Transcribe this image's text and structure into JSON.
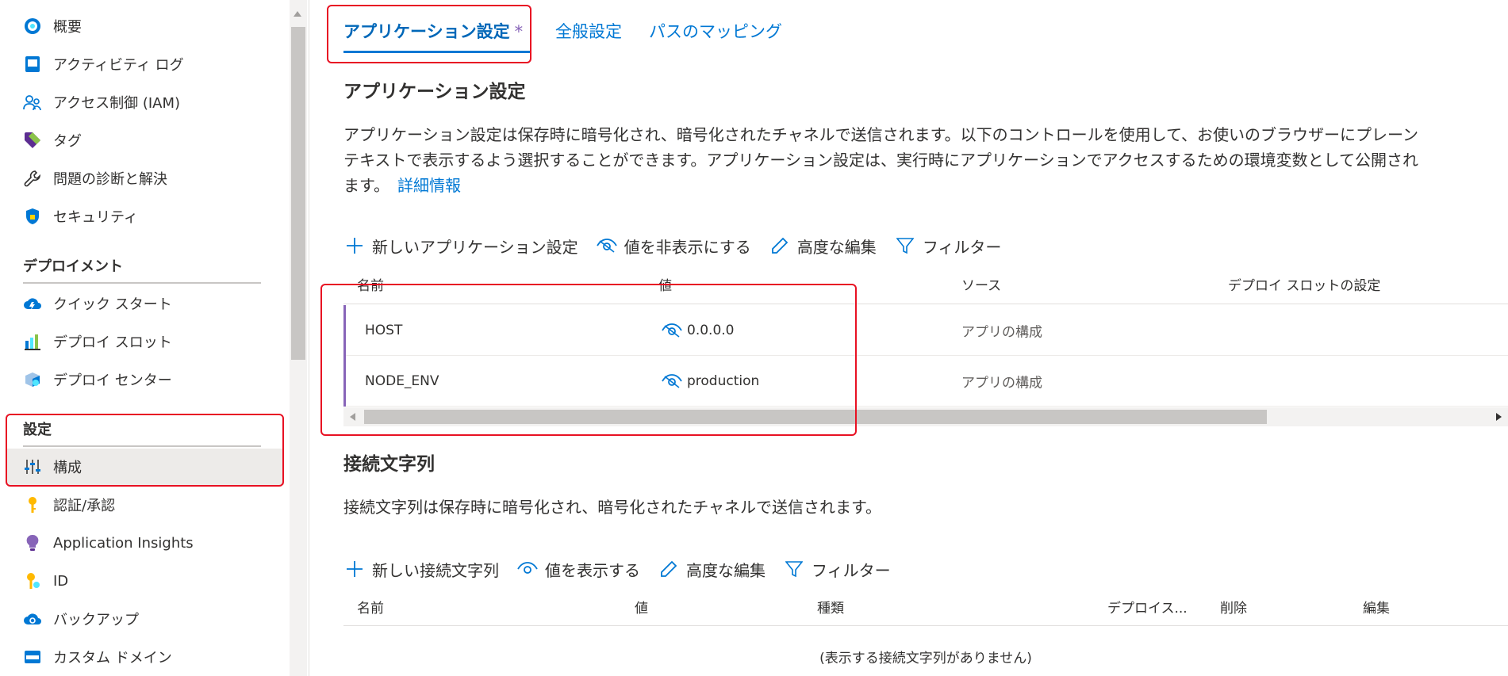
{
  "sidebar": {
    "items_top": [
      {
        "label": "概要",
        "icon": "overview-icon"
      },
      {
        "label": "アクティビティ ログ",
        "icon": "activity-log-icon"
      },
      {
        "label": "アクセス制御 (IAM)",
        "icon": "access-control-icon"
      },
      {
        "label": "タグ",
        "icon": "tag-icon"
      },
      {
        "label": "問題の診断と解決",
        "icon": "wrench-icon"
      },
      {
        "label": "セキュリティ",
        "icon": "shield-icon"
      }
    ],
    "deployment_header": "デプロイメント",
    "deployment_items": [
      {
        "label": "クイック スタート",
        "icon": "cloud-icon"
      },
      {
        "label": "デプロイ スロット",
        "icon": "slots-icon"
      },
      {
        "label": "デプロイ センター",
        "icon": "deploy-center-icon"
      }
    ],
    "settings_header": "設定",
    "settings_items": [
      {
        "label": "構成",
        "icon": "sliders-icon",
        "selected": true
      },
      {
        "label": "認証/承認",
        "icon": "key-icon"
      },
      {
        "label": "Application Insights",
        "icon": "lightbulb-icon"
      },
      {
        "label": "ID",
        "icon": "identity-key-icon"
      },
      {
        "label": "バックアップ",
        "icon": "backup-icon"
      },
      {
        "label": "カスタム ドメイン",
        "icon": "domain-icon"
      }
    ]
  },
  "tabs": [
    {
      "label": "アプリケーション設定",
      "active": true,
      "modified_marker": "*"
    },
    {
      "label": "全般設定",
      "active": false
    },
    {
      "label": "パスのマッピング",
      "active": false
    }
  ],
  "app_settings": {
    "heading": "アプリケーション設定",
    "description_line1": "アプリケーション設定は保存時に暗号化され、暗号化されたチャネルで送信されます。以下のコントロールを使用して、お使いのブラウザーにプレーン",
    "description_line2": "テキストで表示するよう選択することができます。アプリケーション設定は、実行時にアプリケーションでアクセスするための環境変数として公開され",
    "description_line3": "ます。",
    "learn_more": "詳細情報",
    "toolbar": {
      "new": "新しいアプリケーション設定",
      "toggle_values": "値を非表示にする",
      "advanced_edit": "高度な編集",
      "filter": "フィルター"
    },
    "columns": {
      "name": "名前",
      "value": "値",
      "source": "ソース",
      "slot": "デプロイ スロットの設定"
    },
    "rows": [
      {
        "name": "HOST",
        "value": "0.0.0.0",
        "source": "アプリの構成"
      },
      {
        "name": "NODE_ENV",
        "value": "production",
        "source": "アプリの構成"
      }
    ]
  },
  "connection_strings": {
    "heading": "接続文字列",
    "description": "接続文字列は保存時に暗号化され、暗号化されたチャネルで送信されます。",
    "toolbar": {
      "new": "新しい接続文字列",
      "toggle_values": "値を表示する",
      "advanced_edit": "高度な編集",
      "filter": "フィルター"
    },
    "columns": {
      "name": "名前",
      "value": "値",
      "type": "種類",
      "slot": "デプロイス...",
      "delete": "削除",
      "edit": "編集"
    },
    "empty_message": "(表示する接続文字列がありません)"
  },
  "colors": {
    "accent": "#0078d4",
    "modified": "#8764b8",
    "annotation": "#e81123"
  }
}
